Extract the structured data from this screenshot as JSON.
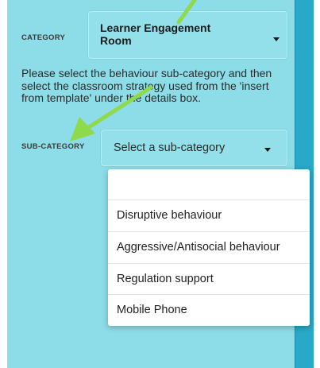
{
  "category": {
    "label": "CATEGORY",
    "selected": "Learner Engagement Room"
  },
  "help_text": "Please select the behaviour sub-category and then select the classroom strategy used from the 'insert from template' under the details box.",
  "sub_category": {
    "label": "SUB-CATEGORY",
    "placeholder": "Select a sub-category"
  },
  "dropdown": {
    "options": [
      "",
      "Disruptive behaviour",
      "Aggressive/Antisocial behaviour",
      "Regulation support",
      "Mobile Phone"
    ]
  },
  "colors": {
    "panel": "#8ddde8",
    "side_strip": "#2aa8c8",
    "annotation_arrow": "#8ed94c"
  },
  "icons": {
    "caret": "chevron-down-icon",
    "annotation": "arrow-annotation"
  }
}
